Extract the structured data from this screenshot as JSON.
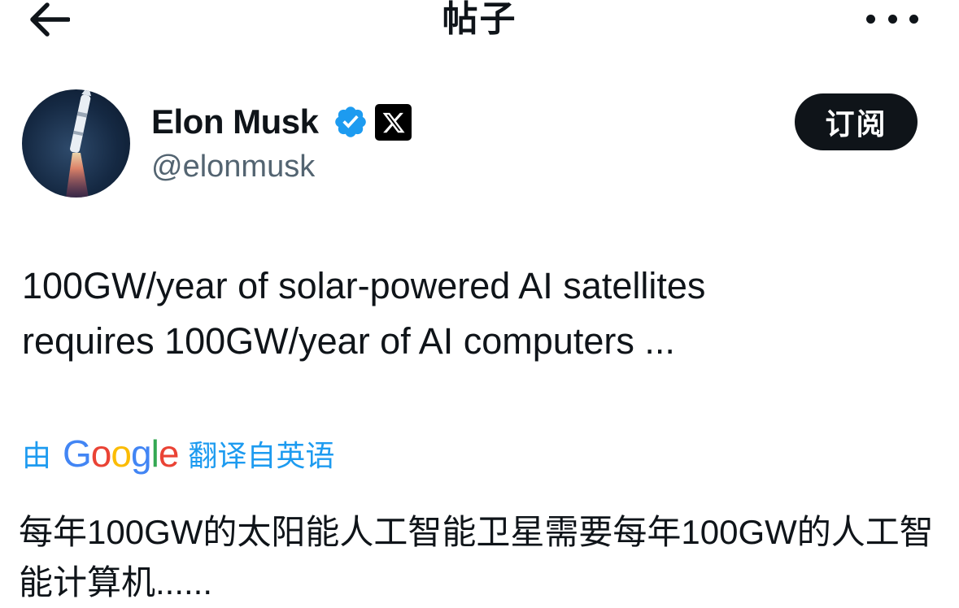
{
  "header": {
    "title": "帖子",
    "back_icon": "arrow-left-icon",
    "more_icon": "more-horizontal-icon"
  },
  "author": {
    "name": "Elon Musk",
    "handle": "@elonmusk",
    "verified_icon": "verified-badge-icon",
    "verified_color": "#1d9bf0",
    "affiliation_icon": "x-logo-icon",
    "avatar": "rocket-launch-avatar"
  },
  "subscribe_label": "订阅",
  "tweet": {
    "text": "100GW/year of solar-powered AI satellites\nrequires 100GW/year of AI computers ..."
  },
  "translation": {
    "prefix": "由",
    "provider": "Google",
    "suffix": "翻译自英语",
    "text": "每年100GW的太阳能人工智能卫星需要每年100GW的人工智能计算机......",
    "link_color": "#1d9bf0"
  }
}
